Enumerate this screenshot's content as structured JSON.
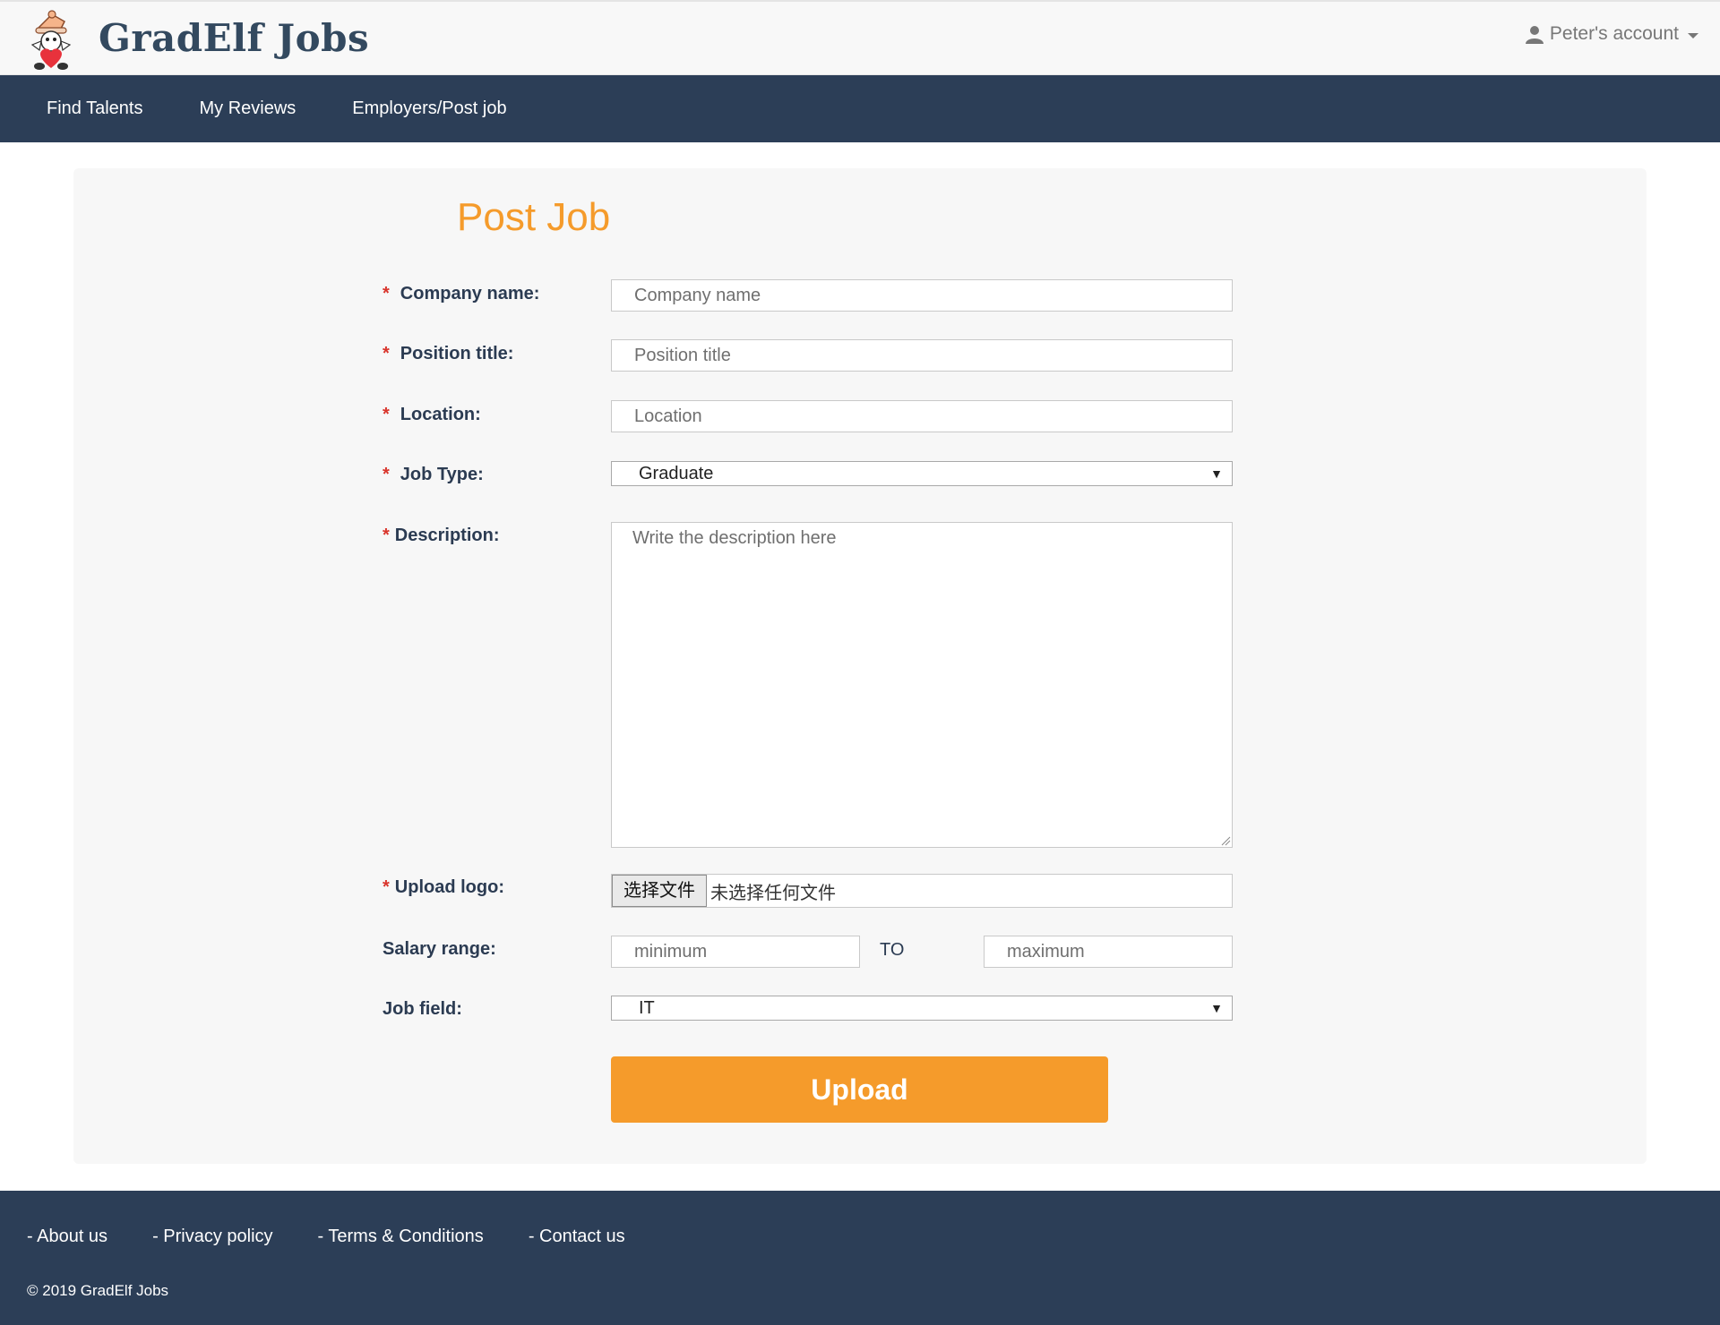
{
  "header": {
    "brand": "GradElf Jobs",
    "account_label": "Peter's account"
  },
  "nav": {
    "items": [
      "Find Talents",
      "My Reviews",
      "Employers/Post job"
    ]
  },
  "form": {
    "title": "Post Job",
    "required_mark": "*",
    "company": {
      "label": "Company name:",
      "placeholder": "Company name"
    },
    "position": {
      "label": "Position title:",
      "placeholder": "Position title"
    },
    "location": {
      "label": "Location:",
      "placeholder": "Location"
    },
    "job_type": {
      "label": "Job Type:",
      "selected": "Graduate"
    },
    "description": {
      "label": "Description:",
      "placeholder": "Write the description here"
    },
    "upload_logo": {
      "label": "Upload logo:",
      "button": "选择文件",
      "status": "未选择任何文件"
    },
    "salary": {
      "label": "Salary range:",
      "min_placeholder": "minimum",
      "to": "TO",
      "max_placeholder": "maximum"
    },
    "job_field": {
      "label": "Job field:",
      "selected": "IT"
    },
    "submit": "Upload"
  },
  "footer": {
    "links": [
      "- About us",
      "- Privacy policy",
      "- Terms & Conditions",
      "- Contact us"
    ],
    "copyright": "© 2019 GradElf Jobs"
  },
  "colors": {
    "accent": "#f59b2b",
    "nav_bg": "#2c3e57",
    "required": "#d9342b"
  }
}
